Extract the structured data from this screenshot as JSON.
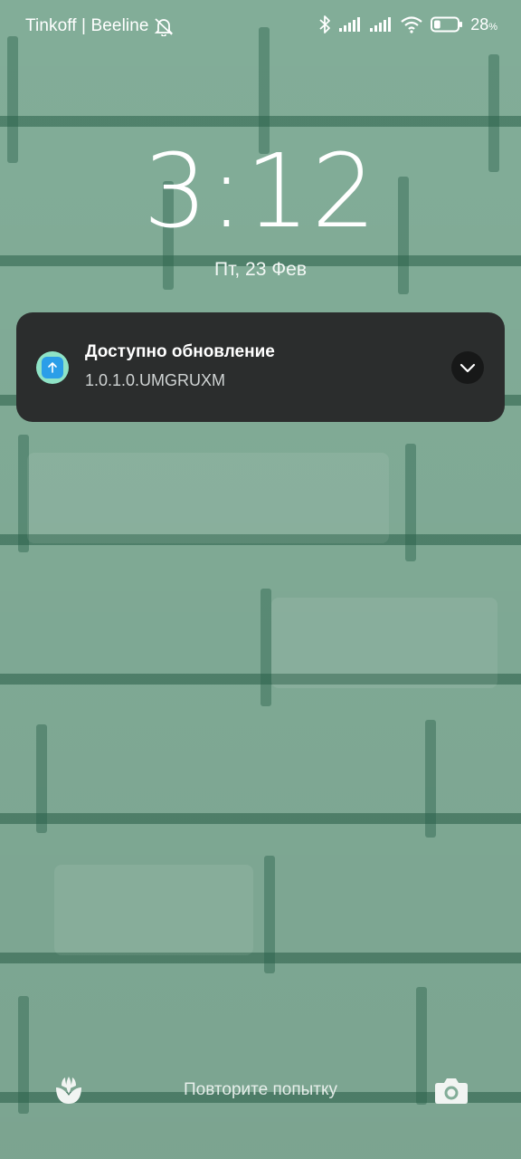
{
  "status_bar": {
    "carrier": "Tinkoff | Beeline",
    "battery_percent": "28",
    "battery_unit": "%",
    "battery_level": 0.28,
    "icons": [
      "alarm-off-icon",
      "bluetooth-icon",
      "signal-icon",
      "signal-icon",
      "wifi-icon",
      "battery-icon"
    ]
  },
  "lockscreen": {
    "time": "3:12",
    "date": "Пт, 23 Фев"
  },
  "notification": {
    "icon": "app-update-icon",
    "title": "Доступно обновление",
    "body": "1.0.1.0.UMGRUXM",
    "expand_icon": "chevron-down-icon"
  },
  "bottom_bar": {
    "left_icon": "flower-icon",
    "hint": "Повторите попытку",
    "right_icon": "camera-icon"
  },
  "colors": {
    "wallpaper": "#82ad98",
    "notification_bg": "#2b2d2d",
    "app_icon_bg": "#8fe3c6",
    "app_icon_accent": "#2b9ee8"
  }
}
